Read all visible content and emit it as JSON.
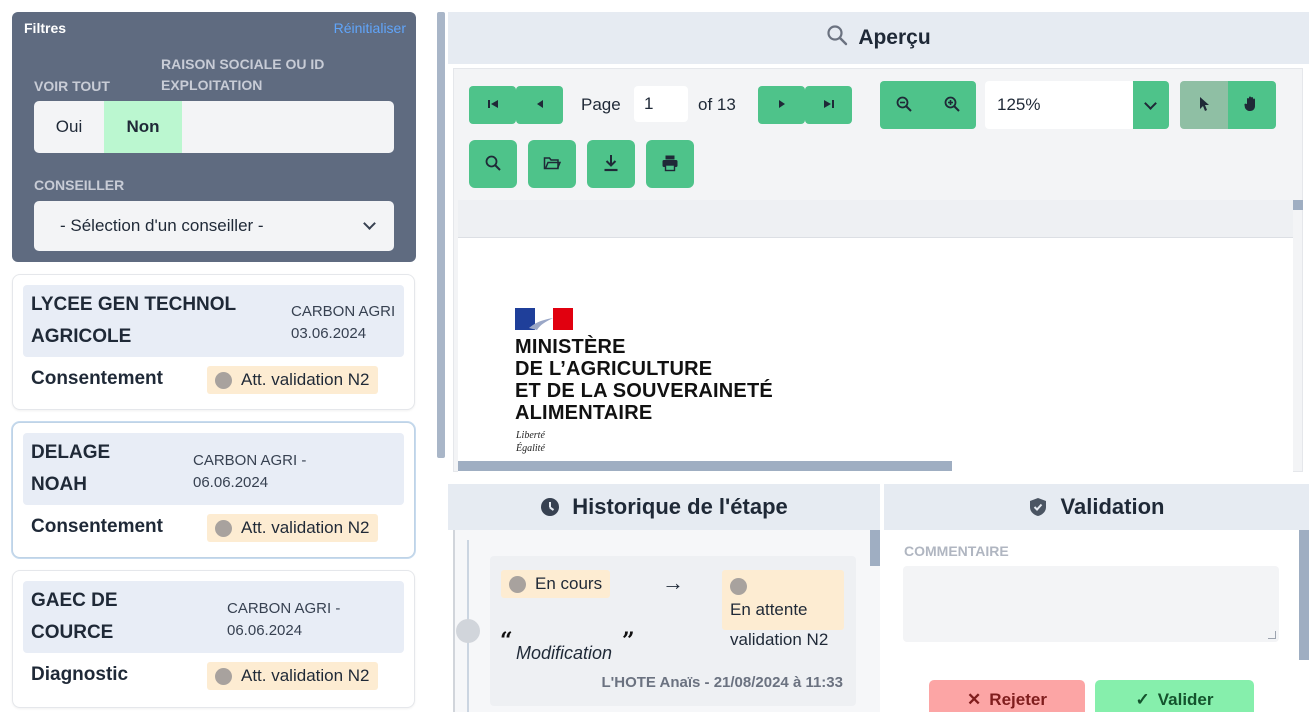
{
  "filters": {
    "title": "Filtres",
    "reset_label": "Réinitialiser",
    "voir_tout_label": "VOIR TOUT",
    "raison_sociale_label": "RAISON SOCIALE OU ID EXPLOITATION",
    "toggle_oui": "Oui",
    "toggle_non": "Non",
    "toggle_selected": "Non",
    "conseiller_label": "CONSEILLER",
    "conseiller_placeholder": "- Sélection d'un conseiller -"
  },
  "cards": [
    {
      "name": "LYCEE GEN TECHNOL AGRICOLE",
      "program": "CARBON AGRI 03.06.2024",
      "step": "Consentement",
      "status": "Att. validation N2",
      "selected": false
    },
    {
      "name": "DELAGE NOAH",
      "program": "CARBON AGRI - 06.06.2024",
      "step": "Consentement",
      "status": "Att. validation N2",
      "selected": true
    },
    {
      "name": "GAEC DE COURCE",
      "program": "CARBON AGRI - 06.06.2024",
      "step": "Diagnostic",
      "status": "Att. validation N2",
      "selected": false
    }
  ],
  "preview": {
    "title": "Aperçu",
    "page_label": "Page",
    "page_current": "1",
    "page_of": "of 13",
    "zoom": "125%",
    "document": {
      "ministry_lines": [
        "MINISTÈRE",
        "DE L’AGRICULTURE",
        "ET DE LA SOUVERAINETÉ",
        "ALIMENTAIRE"
      ],
      "motto": [
        "Liberté",
        "Égalité"
      ]
    },
    "icons": [
      "first-page-icon",
      "prev-page-icon",
      "next-page-icon",
      "last-page-icon",
      "zoom-out-icon",
      "zoom-in-icon",
      "select-tool-icon",
      "hand-tool-icon",
      "search-icon",
      "open-file-icon",
      "download-icon",
      "print-icon"
    ]
  },
  "history": {
    "title": "Historique de l'étape",
    "from_status": "En cours",
    "to_status": "En attente validation N2",
    "comment": "Modification",
    "author": "L'HOTE Anaïs - 21/08/2024 à 11:33"
  },
  "validation": {
    "title": "Validation",
    "comment_label": "COMMENTAIRE",
    "reject_label": "Rejeter",
    "validate_label": "Valider"
  },
  "colors": {
    "accent_green": "#4ec38a",
    "filter_panel": "#5f6b80",
    "status_badge_bg": "#fdecd2",
    "reset_link": "#60a5fa"
  }
}
